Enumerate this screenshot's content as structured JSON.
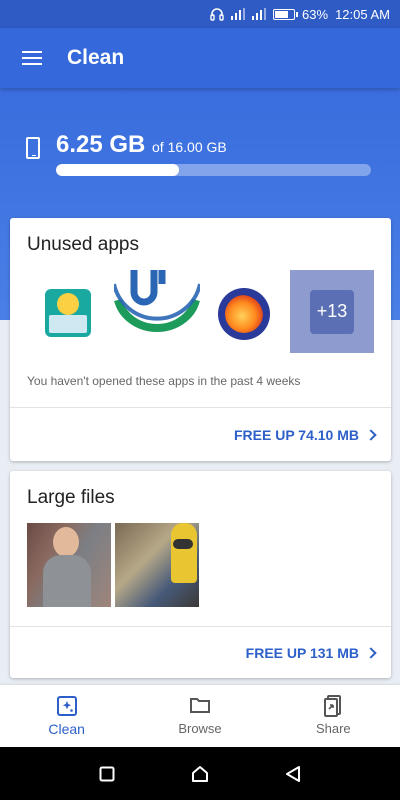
{
  "status_bar": {
    "battery": "63%",
    "time": "12:05 AM",
    "battery_level": 0.63
  },
  "app_bar": {
    "title": "Clean"
  },
  "storage": {
    "used": "6.25 GB",
    "total": "of 16.00 GB",
    "used_fraction": 0.39
  },
  "unused_apps": {
    "title": "Unused apps",
    "more_count": "+13",
    "description": "You haven't opened these apps in the past 4 weeks",
    "action": "FREE UP 74.10 MB"
  },
  "large_files": {
    "title": "Large files",
    "action": "FREE UP 131 MB"
  },
  "bottom_nav": {
    "items": [
      {
        "label": "Clean",
        "icon": "clean-sparkle-icon",
        "active": true
      },
      {
        "label": "Browse",
        "icon": "folder-icon",
        "active": false
      },
      {
        "label": "Share",
        "icon": "share-phone-icon",
        "active": false
      }
    ]
  },
  "colors": {
    "primary": "#3568da",
    "accent": "#2d5fc8"
  }
}
